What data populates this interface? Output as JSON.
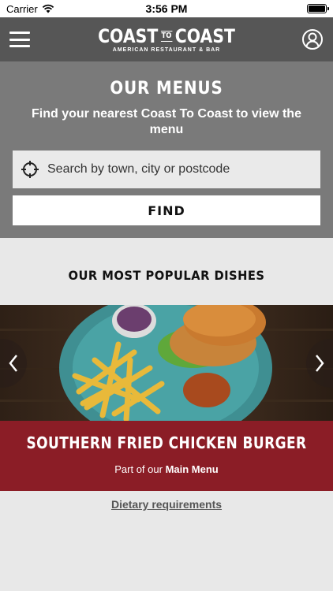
{
  "status_bar": {
    "carrier": "Carrier",
    "time": "3:56 PM"
  },
  "header": {
    "logo_left": "COAST",
    "logo_to": "TO",
    "logo_right": "COAST",
    "logo_tagline": "AMERICAN RESTAURANT & BAR"
  },
  "menus": {
    "title": "OUR MENUS",
    "subtitle": "Find your nearest Coast To Coast to view the menu",
    "search_placeholder": "Search by town, city or postcode",
    "find_label": "FIND"
  },
  "popular": {
    "title": "OUR MOST POPULAR DISHES",
    "dish_name": "SOUTHERN FRIED CHICKEN BURGER",
    "dish_menu_prefix": "Part of our ",
    "dish_menu_name": "Main Menu"
  },
  "footer": {
    "dietary_label": "Dietary requirements"
  },
  "colors": {
    "header": "#565656",
    "menus_bg": "#7a7a7a",
    "banner": "#8b1d26",
    "page_bg": "#e8e8e8"
  },
  "icons": {
    "menu": "hamburger-icon",
    "account": "user-circle-icon",
    "location": "crosshair-icon",
    "prev": "chevron-left-icon",
    "next": "chevron-right-icon"
  }
}
